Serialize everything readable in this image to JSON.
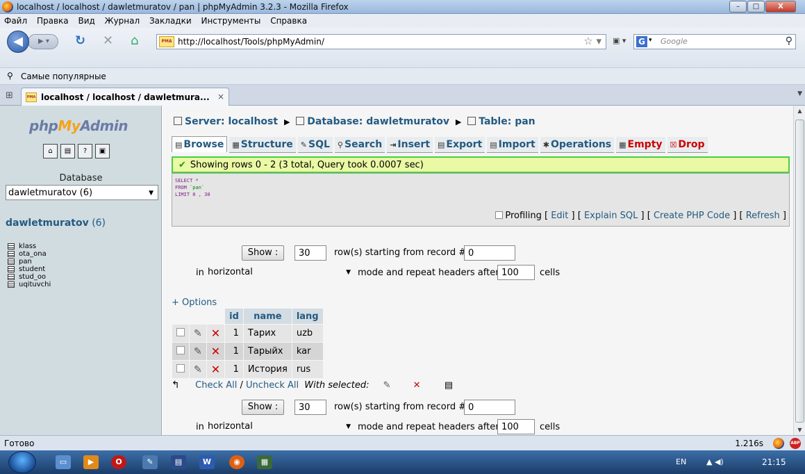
{
  "window": {
    "title": "localhost / localhost / dawletmuratov / pan | phpMyAdmin 3.2.3 - Mozilla Firefox"
  },
  "menu": [
    "Файл",
    "Правка",
    "Вид",
    "Журнал",
    "Закладки",
    "Инструменты",
    "Справка"
  ],
  "nav": {
    "url": "http://localhost/Tools/phpMyAdmin/",
    "search_placeholder": "Google"
  },
  "bookmarks": {
    "label": "Самые популярные"
  },
  "tab": {
    "title": "localhost / localhost / dawletmura..."
  },
  "left": {
    "logo": {
      "php": "php",
      "my": "My",
      "admin": "Admin"
    },
    "database_label": "Database",
    "database_selected": "dawletmuratov (6)",
    "db_name": "dawletmuratov",
    "db_count": "(6)",
    "tables": [
      "klass",
      "ota_ona",
      "pan",
      "student",
      "stud_oo",
      "uqituvchi"
    ]
  },
  "main": {
    "breadcrumb": {
      "server": "Server: localhost",
      "database": "Database: dawletmuratov",
      "table": "Table: pan"
    },
    "tabs": [
      "Browse",
      "Structure",
      "SQL",
      "Search",
      "Insert",
      "Export",
      "Import",
      "Operations",
      "Empty",
      "Drop"
    ],
    "success_message": "Showing rows 0 - 2 (3 total, Query took 0.0007 sec)",
    "sql": {
      "line1": "SELECT *",
      "line2_kw": "FROM ",
      "line2_str": "`pan`",
      "line3": "LIMIT 0 , 30"
    },
    "sql_links": {
      "profiling": "Profiling",
      "edit": "Edit",
      "explain": "Explain SQL",
      "php": "Create PHP Code",
      "refresh": "Refresh"
    },
    "nav_form": {
      "show_button": "Show :",
      "rows_value": "30",
      "rows_text": "row(s) starting from record #",
      "start_value": "0",
      "in_text": "in",
      "mode_value": "horizontal",
      "mode_text": "mode and repeat headers after",
      "repeat_value": "100",
      "cells_text": "cells"
    },
    "options_link": "+ Options",
    "columns": [
      "id",
      "name",
      "lang"
    ],
    "rows": [
      {
        "id": "1",
        "name": "Тарих",
        "lang": "uzb"
      },
      {
        "id": "1",
        "name": "Тарыйх",
        "lang": "kar"
      },
      {
        "id": "1",
        "name": "История",
        "lang": "rus"
      }
    ],
    "check_all": "Check All",
    "uncheck_all": "Uncheck All",
    "with_selected": "With selected:"
  },
  "status": {
    "text": "Готово",
    "timing": "1.216s"
  },
  "taskbar": {
    "lang": "EN",
    "clock": "21:15"
  },
  "colors": {
    "link": "#235a81",
    "success_border": "#44d044",
    "success_bg": "#ebf8a4",
    "left_bg": "#d0dce0"
  }
}
